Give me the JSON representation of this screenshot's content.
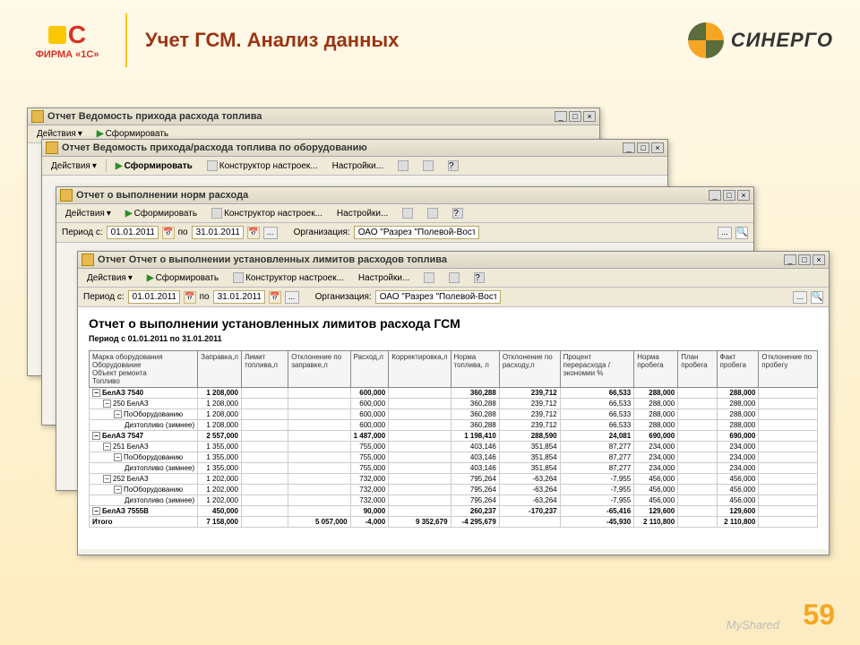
{
  "slide": {
    "title": "Учет ГСМ. Анализ данных",
    "page": "59",
    "watermark": "MyShared",
    "logo1c": "ФИРМА «1С»",
    "synergo": "СИНЕРГО"
  },
  "windows": {
    "w1": {
      "title": "Отчет  Ведомость прихода расхода топлива",
      "actions": "Действия",
      "form": "Сформировать"
    },
    "w2": {
      "title": "Отчет  Ведомость прихода/расхода топлива по оборудованию",
      "actions": "Действия",
      "form": "Сформировать",
      "constructor": "Конструктор настроек...",
      "settings": "Настройки..."
    },
    "w3": {
      "title": "Отчет о выполнении норм расхода",
      "actions": "Действия",
      "form": "Сформировать",
      "constructor": "Конструктор настроек...",
      "settings": "Настройки...",
      "period_from_label": "Период с:",
      "period_from": "01.01.2011",
      "period_to_label": "по",
      "period_to": "31.01.2011",
      "org_label": "Организация:",
      "org": "ОАО \"Разрез \"Полевой-Восточный\""
    },
    "w4": {
      "title": "Отчет  Отчет о выполнении установленных лимитов расходов топлива",
      "actions": "Действия",
      "form": "Сформировать",
      "constructor": "Конструктор настроек...",
      "settings": "Настройки...",
      "period_from_label": "Период с:",
      "period_from": "01.01.2011",
      "period_to_label": "по",
      "period_to": "31.01.2011",
      "org_label": "Организация:",
      "org": "ОАО \"Разрез \"Полевой-Восточный\""
    }
  },
  "report": {
    "title": "Отчет о выполнении установленных лимитов расхода ГСМ",
    "period": "Период с 01.01.2011 по 31.01.2011",
    "headers": [
      "Марка оборудования\nОборудование\nОбъект ремонта\nТопливо",
      "Заправка,л",
      "Лимит топлива,л",
      "Отклонение по заправке,л",
      "Расход,л",
      "Корректировка,л",
      "Норма топлива, л",
      "Отклонение по расходу,л",
      "Процент перерасхода / экономии %",
      "Норма пробега",
      "План пробега",
      "Факт пробега",
      "Отклонение по пробегу"
    ],
    "rows": [
      {
        "lvl": 0,
        "bold": true,
        "label": "БелАЗ 7540",
        "v": [
          "1 208,000",
          "",
          "",
          "600,000",
          "",
          "360,288",
          "239,712",
          "66,533",
          "288,000",
          "",
          "288,000",
          ""
        ]
      },
      {
        "lvl": 1,
        "label": "250 БелАЗ",
        "v": [
          "1 208,000",
          "",
          "",
          "600,000",
          "",
          "360,288",
          "239,712",
          "66,533",
          "288,000",
          "",
          "288,000",
          ""
        ]
      },
      {
        "lvl": 2,
        "label": "ПоОборудованию",
        "v": [
          "1 208,000",
          "",
          "",
          "600,000",
          "",
          "360,288",
          "239,712",
          "66,533",
          "288,000",
          "",
          "288,000",
          ""
        ]
      },
      {
        "lvl": 3,
        "label": "Дизтопливо (зимнее)",
        "v": [
          "1 208,000",
          "",
          "",
          "600,000",
          "",
          "360,288",
          "239,712",
          "66,533",
          "288,000",
          "",
          "288,000",
          ""
        ]
      },
      {
        "lvl": 0,
        "bold": true,
        "label": "БелАЗ 7547",
        "v": [
          "2 557,000",
          "",
          "",
          "1 487,000",
          "",
          "1 198,410",
          "288,590",
          "24,081",
          "690,000",
          "",
          "690,000",
          ""
        ]
      },
      {
        "lvl": 1,
        "label": "251 БелАЗ",
        "v": [
          "1 355,000",
          "",
          "",
          "755,000",
          "",
          "403,146",
          "351,854",
          "87,277",
          "234,000",
          "",
          "234,000",
          ""
        ]
      },
      {
        "lvl": 2,
        "label": "ПоОборудованию",
        "v": [
          "1 355,000",
          "",
          "",
          "755,000",
          "",
          "403,146",
          "351,854",
          "87,277",
          "234,000",
          "",
          "234,000",
          ""
        ]
      },
      {
        "lvl": 3,
        "label": "Дизтопливо (зимнее)",
        "v": [
          "1 355,000",
          "",
          "",
          "755,000",
          "",
          "403,146",
          "351,854",
          "87,277",
          "234,000",
          "",
          "234,000",
          ""
        ]
      },
      {
        "lvl": 1,
        "label": "252 БелАЗ",
        "v": [
          "1 202,000",
          "",
          "",
          "732,000",
          "",
          "795,264",
          "-63,264",
          "-7,955",
          "456,000",
          "",
          "456,000",
          ""
        ]
      },
      {
        "lvl": 2,
        "label": "ПоОборудованию",
        "v": [
          "1 202,000",
          "",
          "",
          "732,000",
          "",
          "795,264",
          "-63,264",
          "-7,955",
          "456,000",
          "",
          "456,000",
          ""
        ]
      },
      {
        "lvl": 3,
        "label": "Дизтопливо (зимнее)",
        "v": [
          "1 202,000",
          "",
          "",
          "732,000",
          "",
          "795,264",
          "-63,264",
          "-7,955",
          "456,000",
          "",
          "456,000",
          ""
        ]
      },
      {
        "lvl": 0,
        "bold": true,
        "label": "БелАЗ 7555В",
        "v": [
          "450,000",
          "",
          "",
          "90,000",
          "",
          "260,237",
          "-170,237",
          "-65,416",
          "129,600",
          "",
          "129,600",
          ""
        ]
      },
      {
        "lvl": 0,
        "itog": true,
        "label": "Итого",
        "v": [
          "7 158,000",
          "",
          "5 057,000",
          "-4,000",
          "9 352,679",
          "-4 295,679",
          "",
          "-45,930",
          "2 110,800",
          "",
          "2 110,800",
          ""
        ]
      }
    ]
  }
}
